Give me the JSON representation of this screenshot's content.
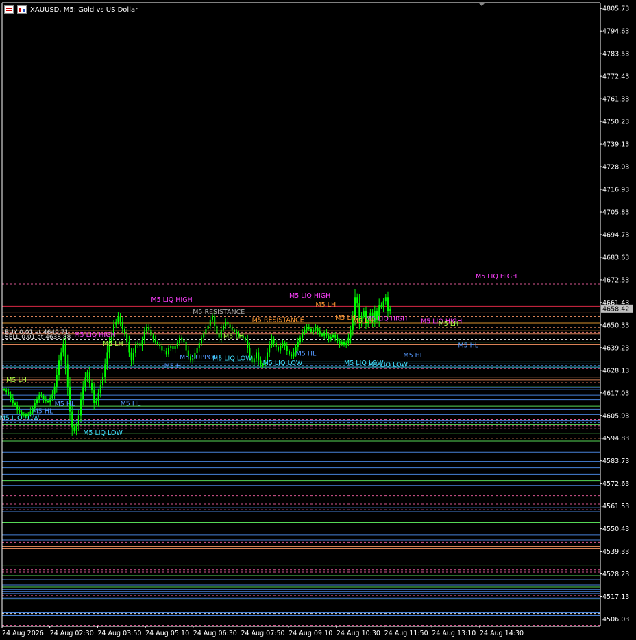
{
  "header": {
    "symbol_text": "XAUUSD, M5:  Gold vs US Dollar",
    "icons": [
      "list-icon",
      "chart-icon",
      "menu-triangle-icon"
    ]
  },
  "trades": {
    "buy_label": "BUY 0.01 at 4640.71",
    "sell_label": "SELL 0.01 at 4638.88"
  },
  "colors": {
    "background": "#000000",
    "candle": "#00ff00",
    "axis": "#ffffff",
    "price_tag_bg": "#c0c0c0",
    "liq_high": "#ff40ff",
    "swing_high": "#ff9933",
    "support": "#5599ff",
    "liq_low": "#40e0ff"
  },
  "chart_data": {
    "type": "candlestick",
    "current_price": "4658.42",
    "y_ticks": [
      "4805.73",
      "4794.63",
      "4783.53",
      "4772.43",
      "4761.33",
      "4750.23",
      "4739.13",
      "4728.03",
      "4716.93",
      "4705.83",
      "4694.73",
      "4683.63",
      "4672.53",
      "4661.43",
      "4650.33",
      "4639.23",
      "4628.13",
      "4617.03",
      "4605.93",
      "4594.83",
      "4583.73",
      "4572.63",
      "4561.53",
      "4550.43",
      "4539.33",
      "4528.23",
      "4517.13",
      "4506.03"
    ],
    "ylim": [
      4502.5,
      4808.5
    ],
    "x_ticks": [
      "24 Aug 2026",
      "24 Aug 02:30",
      "24 Aug 03:50",
      "24 Aug 05:10",
      "24 Aug 06:30",
      "24 Aug 07:50",
      "24 Aug 09:10",
      "24 Aug 10:30",
      "24 Aug 11:50",
      "24 Aug 13:10",
      "24 Aug 14:30"
    ],
    "closes": [
      4618.5,
      4617.5,
      4616.5,
      4614.5,
      4612.0,
      4611.0,
      4608.5,
      4607.5,
      4606.0,
      4606.5,
      4605.5,
      4606.5,
      4608.0,
      4609.5,
      4612.0,
      4614.0,
      4616.0,
      4615.5,
      4614.0,
      4613.0,
      4612.5,
      4614.5,
      4616.5,
      4620.0,
      4626.0,
      4633.0,
      4637.0,
      4641.0,
      4631.0,
      4620.0,
      4608.0,
      4600.0,
      4598.5,
      4601.0,
      4606.0,
      4614.0,
      4620.0,
      4624.5,
      4627.0,
      4622.0,
      4618.5,
      4612.0,
      4613.0,
      4617.0,
      4621.0,
      4625.0,
      4631.0,
      4637.0,
      4642.0,
      4645.0,
      4650.5,
      4652.0,
      4654.5,
      4652.0,
      4648.5,
      4646.0,
      4642.0,
      4637.0,
      4633.0,
      4636.5,
      4640.5,
      4641.5,
      4640.0,
      4643.0,
      4647.0,
      4649.5,
      4648.0,
      4645.0,
      4643.5,
      4642.0,
      4641.0,
      4640.0,
      4638.0,
      4637.5,
      4636.0,
      4639.0,
      4640.0,
      4638.5,
      4640.0,
      4641.5,
      4644.0,
      4643.0,
      4642.0,
      4638.0,
      4635.0,
      4633.0,
      4634.0,
      4636.5,
      4639.0,
      4641.5,
      4644.0,
      4646.0,
      4648.5,
      4650.0,
      4653.0,
      4655.0,
      4650.0,
      4646.0,
      4644.0,
      4648.0,
      4650.0,
      4652.0,
      4650.5,
      4649.0,
      4648.0,
      4647.0,
      4646.0,
      4645.0,
      4645.0,
      4644.0,
      4643.0,
      4639.0,
      4635.0,
      4632.0,
      4634.0,
      4637.0,
      4633.0,
      4631.0,
      4630.5,
      4633.0,
      4637.0,
      4640.5,
      4643.5,
      4641.5,
      4639.5,
      4638.0,
      4640.0,
      4641.5,
      4640.0,
      4637.5,
      4636.0,
      4635.0,
      4637.0,
      4639.5,
      4642.0,
      4644.0,
      4646.5,
      4648.0,
      4649.5,
      4648.5,
      4647.0,
      4648.0,
      4649.0,
      4647.5,
      4646.0,
      4645.0,
      4646.5,
      4645.0,
      4643.5,
      4644.5,
      4645.5,
      4644.0,
      4642.5,
      4641.0,
      4642.0,
      4640.5,
      4641.5,
      4644.0,
      4648.0,
      4654.0,
      4664.0,
      4661.0,
      4652.0,
      4655.0,
      4657.0,
      4651.0,
      4653.0,
      4656.0,
      4652.0,
      4657.0,
      4653.0,
      4660.0,
      4659.0,
      4662.0,
      4664.0,
      4657.0,
      4658.4
    ],
    "levels": [
      {
        "v": 4670.5,
        "c": "#ff66aa",
        "d": 1
      },
      {
        "v": 4659.6,
        "c": "#ff3050",
        "d": 0
      },
      {
        "v": 4658.2,
        "c": "#ff9966",
        "d": 1
      },
      {
        "v": 4656.2,
        "c": "#ff9966",
        "d": 0
      },
      {
        "v": 4654.5,
        "c": "#ff9966",
        "d": 1
      },
      {
        "v": 4651.3,
        "c": "#ffaa33",
        "d": 0
      },
      {
        "v": 4649.2,
        "c": "#ff9966",
        "d": 1
      },
      {
        "v": 4647.5,
        "c": "#ffaa33",
        "d": 0
      },
      {
        "v": 4646.8,
        "c": "#ff8888",
        "d": 1
      },
      {
        "v": 4646.0,
        "c": "#ff9966",
        "d": 0
      },
      {
        "v": 4643.4,
        "c": "#ffffff",
        "d": 1
      },
      {
        "v": 4642.0,
        "c": "#66ff66",
        "d": 0
      },
      {
        "v": 4640.7,
        "c": "#ff9966",
        "d": 0
      },
      {
        "v": 4640.0,
        "c": "#66ff66",
        "d": 0
      },
      {
        "v": 4632.3,
        "c": "#44ddff",
        "d": 0
      },
      {
        "v": 4631.3,
        "c": "#44ddff",
        "d": 0
      },
      {
        "v": 4630.5,
        "c": "#5599ff",
        "d": 1
      },
      {
        "v": 4629.7,
        "c": "#44ddff",
        "d": 0
      },
      {
        "v": 4629.0,
        "c": "#ff66aa",
        "d": 1
      },
      {
        "v": 4624.8,
        "c": "#ff9966",
        "d": 0
      },
      {
        "v": 4623.4,
        "c": "#ff9966",
        "d": 0
      },
      {
        "v": 4622.0,
        "c": "#ff8866",
        "d": 1
      },
      {
        "v": 4620.4,
        "c": "#66ff66",
        "d": 0
      },
      {
        "v": 4619.7,
        "c": "#5599ff",
        "d": 0
      },
      {
        "v": 4618.6,
        "c": "#5599ff",
        "d": 0
      },
      {
        "v": 4615.9,
        "c": "#5599ff",
        "d": 0
      },
      {
        "v": 4613.7,
        "c": "#5599ff",
        "d": 0
      },
      {
        "v": 4610.5,
        "c": "#66ff66",
        "d": 0
      },
      {
        "v": 4609.1,
        "c": "#5599ff",
        "d": 0
      },
      {
        "v": 4606.4,
        "c": "#5599ff",
        "d": 0
      },
      {
        "v": 4604.0,
        "c": "#ff66aa",
        "d": 1
      },
      {
        "v": 4603.3,
        "c": "#5599ff",
        "d": 0
      },
      {
        "v": 4602.6,
        "c": "#5599ff",
        "d": 1
      },
      {
        "v": 4601.6,
        "c": "#66ff66",
        "d": 0
      },
      {
        "v": 4600.9,
        "c": "#ff66aa",
        "d": 1
      },
      {
        "v": 4599.4,
        "c": "#ff66aa",
        "d": 1
      },
      {
        "v": 4597.0,
        "c": "#66ff66",
        "d": 0
      },
      {
        "v": 4594.8,
        "c": "#ff9966",
        "d": 1
      },
      {
        "v": 4593.4,
        "c": "#66ff66",
        "d": 0
      },
      {
        "v": 4587.9,
        "c": "#5599ff",
        "d": 0
      },
      {
        "v": 4583.4,
        "c": "#5599ff",
        "d": 0
      },
      {
        "v": 4580.4,
        "c": "#5599ff",
        "d": 0
      },
      {
        "v": 4577.1,
        "c": "#5599ff",
        "d": 0
      },
      {
        "v": 4574.0,
        "c": "#66ff66",
        "d": 0
      },
      {
        "v": 4571.6,
        "c": "#5599ff",
        "d": 0
      },
      {
        "v": 4566.6,
        "c": "#ff66aa",
        "d": 1
      },
      {
        "v": 4562.4,
        "c": "#ff66aa",
        "d": 1
      },
      {
        "v": 4560.7,
        "c": "#5599ff",
        "d": 0
      },
      {
        "v": 4559.7,
        "c": "#ff66aa",
        "d": 1
      },
      {
        "v": 4558.7,
        "c": "#5599ff",
        "d": 0
      },
      {
        "v": 4553.5,
        "c": "#66ff66",
        "d": 0
      },
      {
        "v": 4547.3,
        "c": "#5599ff",
        "d": 0
      },
      {
        "v": 4544.9,
        "c": "#5599ff",
        "d": 0
      },
      {
        "v": 4543.8,
        "c": "#ff66aa",
        "d": 1
      },
      {
        "v": 4541.7,
        "c": "#ff9966",
        "d": 0
      },
      {
        "v": 4540.7,
        "c": "#ff9966",
        "d": 0
      },
      {
        "v": 4538.0,
        "c": "#ff9966",
        "d": 1
      },
      {
        "v": 4532.6,
        "c": "#66ff66",
        "d": 0
      },
      {
        "v": 4530.2,
        "c": "#ff66aa",
        "d": 1
      },
      {
        "v": 4529.1,
        "c": "#ff66aa",
        "d": 1
      },
      {
        "v": 4527.4,
        "c": "#66ff66",
        "d": 0
      },
      {
        "v": 4525.4,
        "c": "#5599ff",
        "d": 0
      },
      {
        "v": 4522.7,
        "c": "#5599ff",
        "d": 0
      },
      {
        "v": 4521.7,
        "c": "#66ff66",
        "d": 0
      },
      {
        "v": 4520.6,
        "c": "#5599ff",
        "d": 0
      },
      {
        "v": 4519.6,
        "c": "#5599ff",
        "d": 0
      },
      {
        "v": 4518.6,
        "c": "#5599ff",
        "d": 0
      },
      {
        "v": 4517.6,
        "c": "#ff66aa",
        "d": 1
      },
      {
        "v": 4516.2,
        "c": "#5599ff",
        "d": 0
      },
      {
        "v": 4515.5,
        "c": "#66ff66",
        "d": 0
      },
      {
        "v": 4509.4,
        "c": "#5599ff",
        "d": 0
      },
      {
        "v": 4508.7,
        "c": "#ffffff",
        "d": 1
      },
      {
        "v": 4507.7,
        "c": "#5599ff",
        "d": 0
      },
      {
        "v": 4503.0,
        "c": "#ff66aa",
        "d": 1
      }
    ],
    "labels": [
      {
        "t": "M5 LIQ HIGH",
        "i": 67,
        "v": 4661.8,
        "c": "#ff40ff"
      },
      {
        "t": "M5 LIQ HIGH",
        "i": 32,
        "v": 4644.5,
        "c": "#ff40ff"
      },
      {
        "t": "M5 LIQ HIGH",
        "i": 130,
        "v": 4663.8,
        "c": "#ff40ff"
      },
      {
        "t": "M5 LIQ HIGH",
        "i": 165,
        "v": 4652.4,
        "c": "#ff40ff"
      },
      {
        "t": "M5 LIQ HIGH",
        "i": 190,
        "v": 4651.2,
        "c": "#ff40ff"
      },
      {
        "t": "M5 LIQ HIGH",
        "i": 215,
        "v": 4673.2,
        "c": "#ff40ff"
      },
      {
        "t": "M5 RESISTANCE",
        "i": 86,
        "v": 4655.7,
        "c": "#aaaaaa"
      },
      {
        "t": "M5 RESISTANCE",
        "i": 113,
        "v": 4651.8,
        "c": "#ff9933"
      },
      {
        "t": "M5 LH",
        "i": 142,
        "v": 4659.3,
        "c": "#ff9933"
      },
      {
        "t": "M5 LH",
        "i": 151,
        "v": 4653.0,
        "c": "#ff9933"
      },
      {
        "t": "M5 LH",
        "i": 159,
        "v": 4651.3,
        "c": "#ff9933"
      },
      {
        "t": "M5 LH",
        "i": 45,
        "v": 4640.1,
        "c": "#aaff44"
      },
      {
        "t": "M5 LH",
        "i": 100,
        "v": 4643.8,
        "c": "#aaff44"
      },
      {
        "t": "M5 LH",
        "i": 1,
        "v": 4622.4,
        "c": "#aaff44"
      },
      {
        "t": "M5 LH",
        "i": 198,
        "v": 4649.9,
        "c": "#aaff44"
      },
      {
        "t": "M5 SUPPORT",
        "i": 80,
        "v": 4633.5,
        "c": "#5599ff"
      },
      {
        "t": "M5 HL",
        "i": 73,
        "v": 4629.3,
        "c": "#5599ff"
      },
      {
        "t": "M5 HL",
        "i": 23,
        "v": 4610.5,
        "c": "#5599ff"
      },
      {
        "t": "M5 HL",
        "i": 13,
        "v": 4607.0,
        "c": "#5599ff"
      },
      {
        "t": "M5 HL",
        "i": 53,
        "v": 4610.8,
        "c": "#5599ff"
      },
      {
        "t": "M5 HL",
        "i": 133,
        "v": 4635.3,
        "c": "#5599ff"
      },
      {
        "t": "M5 HL",
        "i": 182,
        "v": 4634.5,
        "c": "#5599ff"
      },
      {
        "t": "M5 HL",
        "i": 207,
        "v": 4639.3,
        "c": "#5599ff"
      },
      {
        "t": "M5 LIQ LOW",
        "i": 95,
        "v": 4633.0,
        "c": "#40e0ff"
      },
      {
        "t": "M5 LIQ LOW",
        "i": 118,
        "v": 4630.8,
        "c": "#40e0ff"
      },
      {
        "t": "M5 LIQ LOW",
        "i": 155,
        "v": 4630.8,
        "c": "#40e0ff"
      },
      {
        "t": "M5 LIQ LOW",
        "i": 166,
        "v": 4629.9,
        "c": "#40e0ff"
      },
      {
        "t": "M5 LIQ LOW",
        "i": -2,
        "v": 4603.7,
        "c": "#40e0ff"
      },
      {
        "t": "M5 LIQ LOW",
        "i": 36,
        "v": 4596.5,
        "c": "#40e0ff"
      }
    ]
  }
}
